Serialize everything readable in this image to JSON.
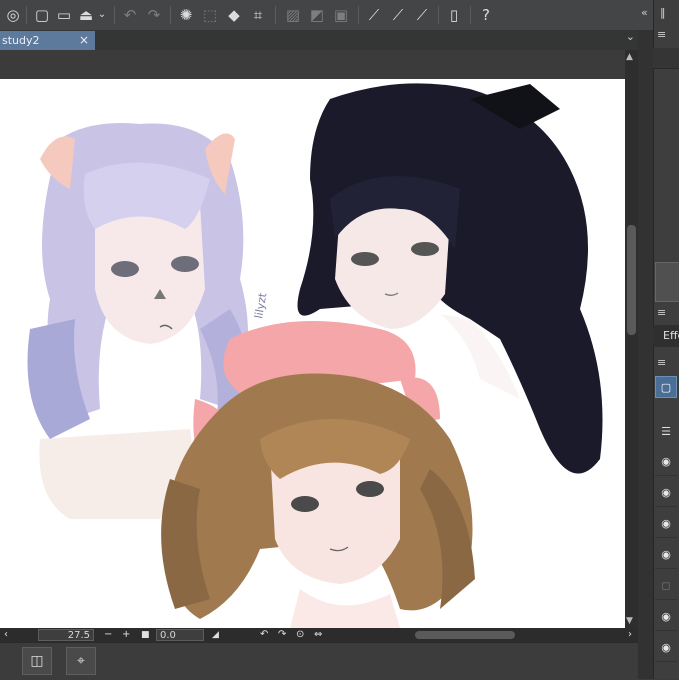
{
  "toolbar": {
    "icons": [
      "clip-studio-icon",
      "new-icon",
      "open-icon",
      "save-icon",
      "dropdown-icon",
      "undo-icon",
      "redo-icon",
      "busy-icon",
      "clear-icon",
      "fill-icon",
      "transform-icon",
      "deselect-icon",
      "invert-selection-icon",
      "show-selection-icon",
      "ruler-icon",
      "ruler-snap-icon",
      "pen-ruler-icon",
      "tablet-icon",
      "help-icon"
    ]
  },
  "document": {
    "tab_label": "study2",
    "tab_close": "×",
    "tab_menu": "⌄"
  },
  "canvas": {
    "artwork_description_visible": "",
    "signature": "lilyzt"
  },
  "status": {
    "zoom": "27.5",
    "zoom_minus": "−",
    "zoom_plus": "+",
    "angle": "0.0",
    "arrow_left": "‹",
    "arrow_right": "›"
  },
  "right_panel": {
    "effect_label": "Effe"
  },
  "colors": {
    "accent_tab": "#5d7a9d",
    "toolbar_bg": "#444546",
    "canvas_bg": "#ffffff",
    "hair_black": "#1a1a2a",
    "hair_brown": "#a07a4e",
    "hair_lavender": "#c9c3e6",
    "ribbon_pink": "#f5a6a8"
  }
}
